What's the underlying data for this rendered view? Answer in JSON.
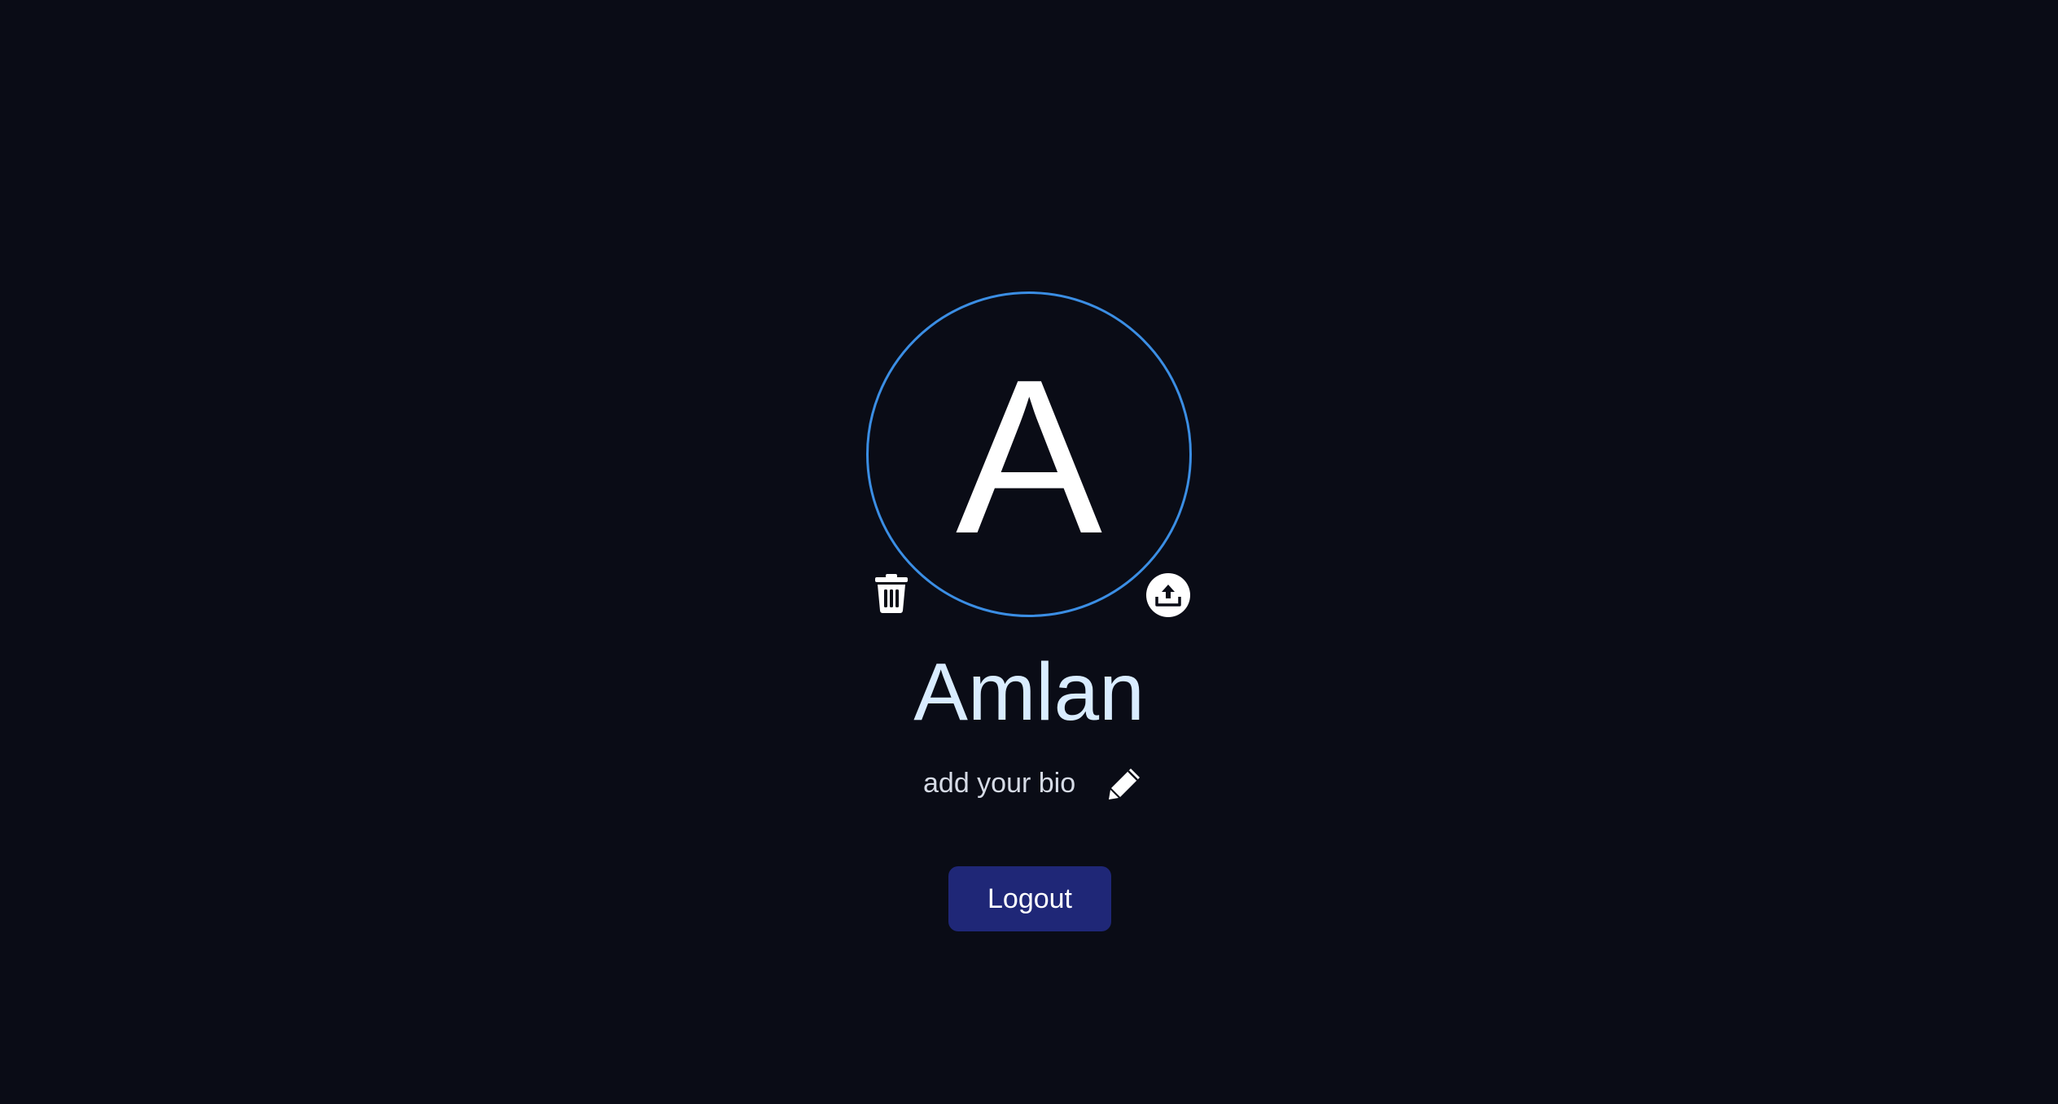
{
  "profile": {
    "avatar_initial": "A",
    "name": "Amlan",
    "bio_placeholder": "add your bio"
  },
  "actions": {
    "delete_icon": "trash-icon",
    "upload_icon": "upload-icon",
    "edit_icon": "pencil-icon",
    "logout_label": "Logout"
  },
  "colors": {
    "background": "#0a0c16",
    "avatar_ring": "#3b8ee4",
    "name_text": "#d9ecff",
    "logout_button": "#1f2777"
  }
}
